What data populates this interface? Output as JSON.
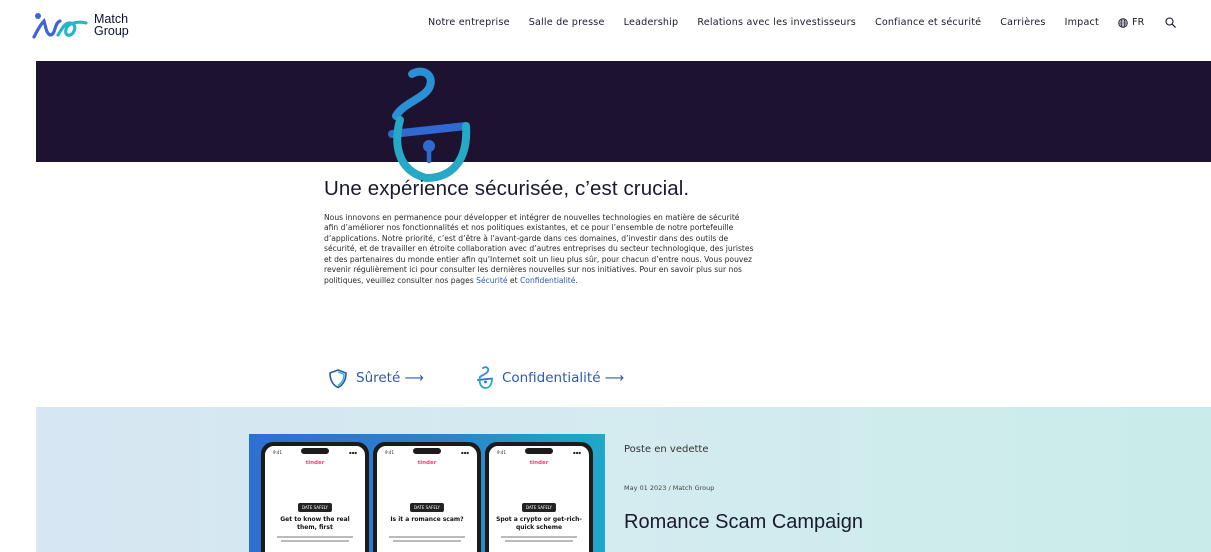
{
  "brand": {
    "name_line1": "Match",
    "name_line2": "Group"
  },
  "nav": {
    "items": [
      {
        "label": "Notre entreprise"
      },
      {
        "label": "Salle de presse"
      },
      {
        "label": "Leadership"
      },
      {
        "label": "Relations avec les investisseurs"
      },
      {
        "label": "Confiance et sécurité"
      },
      {
        "label": "Carrières"
      },
      {
        "label": "Impact"
      }
    ],
    "language": "FR",
    "globe_icon": "globe-icon",
    "search_icon": "search-icon"
  },
  "hero": {
    "icon": "lock-icon",
    "bg_color": "#1e1231"
  },
  "intro": {
    "title": "Une expérience sécurisée, c’est crucial.",
    "body": "Nous innovons en permanence pour développer et intégrer de nouvelles technologies en matière de sécurité afin d’améliorer nos fonctionnalités et nos politiques existantes, et ce pour l’ensemble de notre portefeuille d’applications. Notre priorité, c’est d’être à l’avant-garde dans ces domaines, d’investir dans des outils de sécurité, et de travailler en étroite collaboration avec d’autres entreprises du secteur technologique, des juristes et des partenaires du monde entier afin qu’Internet soit un lieu plus sûr, pour chacun d’entre nous. Vous pouvez revenir régulièrement ici pour consulter les dernières nouvelles sur nos initiatives. Pour en savoir plus sur nos politiques, veuillez consulter nos pages",
    "link_security": "Sécurité",
    "conjunction": "et",
    "link_privacy": "Confidentialité",
    "end_punct": "."
  },
  "links": {
    "safety": {
      "label": "Sûreté ⟶",
      "icon": "shield-icon"
    },
    "privacy": {
      "label": "Confidentialité ⟶",
      "icon": "lock-icon"
    }
  },
  "featured": {
    "label": "Poste en vedette",
    "meta": "May 01 2023 / Match Group",
    "title": "Romance Scam Campaign",
    "phones": [
      {
        "brand": "tinder",
        "time": "9:41",
        "badge": "DATE SAFELY",
        "headline": "Get to know the real them, first"
      },
      {
        "brand": "tinder",
        "time": "9:41",
        "badge": "DATE SAFELY",
        "headline": "Is it a romance scam?"
      },
      {
        "brand": "tinder",
        "time": "9:41",
        "badge": "DATE SAFELY",
        "headline": "Spot a crypto or get-rich-quick scheme"
      }
    ]
  },
  "colors": {
    "accent_blue": "#2e5aa8",
    "dark_navy": "#1e1231",
    "teal": "#29a8c8"
  }
}
